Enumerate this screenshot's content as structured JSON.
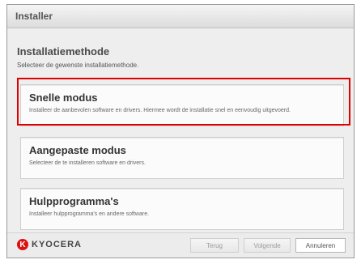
{
  "window": {
    "title": "Installer"
  },
  "page": {
    "heading": "Installatiemethode",
    "subtext": "Selecteer de gewenste installatiemethode."
  },
  "options": [
    {
      "title": "Snelle modus",
      "description": "Installeer de aanbevolen software en drivers. Hiermee wordt de installatie snel en eenvoudig uitgevoerd."
    },
    {
      "title": "Aangepaste modus",
      "description": "Selecteer de te installeren software en drivers."
    },
    {
      "title": "Hulpprogramma's",
      "description": "Installeer hulpprogramma's en andere software."
    }
  ],
  "footer": {
    "logo_text": "KYOCERA",
    "logo_mark": "K",
    "back_label": "Terug",
    "next_label": "Volgende",
    "cancel_label": "Annuleren"
  },
  "colors": {
    "highlight": "#e00000",
    "logo": "#dd1111"
  }
}
